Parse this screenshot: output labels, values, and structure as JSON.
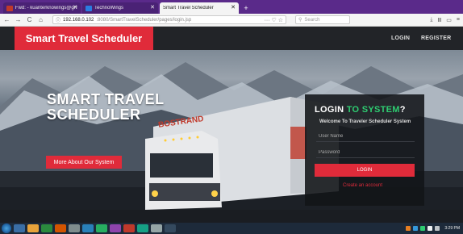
{
  "browser": {
    "tabs": [
      {
        "label": "Fwd: - kuanterknowings@gm",
        "active": false,
        "icon": "gmail-icon"
      },
      {
        "label": "TechnoWings",
        "active": false,
        "icon": "site-icon"
      },
      {
        "label": "Smart Travel Scheduler",
        "active": true,
        "icon": ""
      }
    ],
    "new_tab": "+",
    "url_host": "192.168.0.102",
    "url_path": ":8080/SmartTravelScheduler/pages/login.jsp",
    "url_actions": "··· ♡ ☆",
    "search_placeholder": "Search",
    "back": "←",
    "forward": "→",
    "reload": "C",
    "home": "⌂",
    "info": "ⓘ"
  },
  "header": {
    "brand": "Smart Travel Scheduler",
    "nav": {
      "login": "LOGIN",
      "register": "REGISTER"
    }
  },
  "hero": {
    "title_line1": "SMART TRAVEL",
    "title_line2": "SCHEDULER",
    "about_button": "More About Our System",
    "truck_text": "BOSTRAND"
  },
  "login": {
    "heading_part1": "LOGIN ",
    "heading_part2": "TO SYSTEM",
    "heading_part3": "?",
    "subtitle": "Welcome To Traveler Scheduler System",
    "username_placeholder": "User Name",
    "password_placeholder": "Password",
    "submit": "LOGIN",
    "create_account": "Create an account"
  },
  "taskbar": {
    "clock": "3:29 PM"
  },
  "colors": {
    "accent_red": "#e02b3a",
    "accent_green": "#2ecc71",
    "header_dark": "#222428"
  }
}
